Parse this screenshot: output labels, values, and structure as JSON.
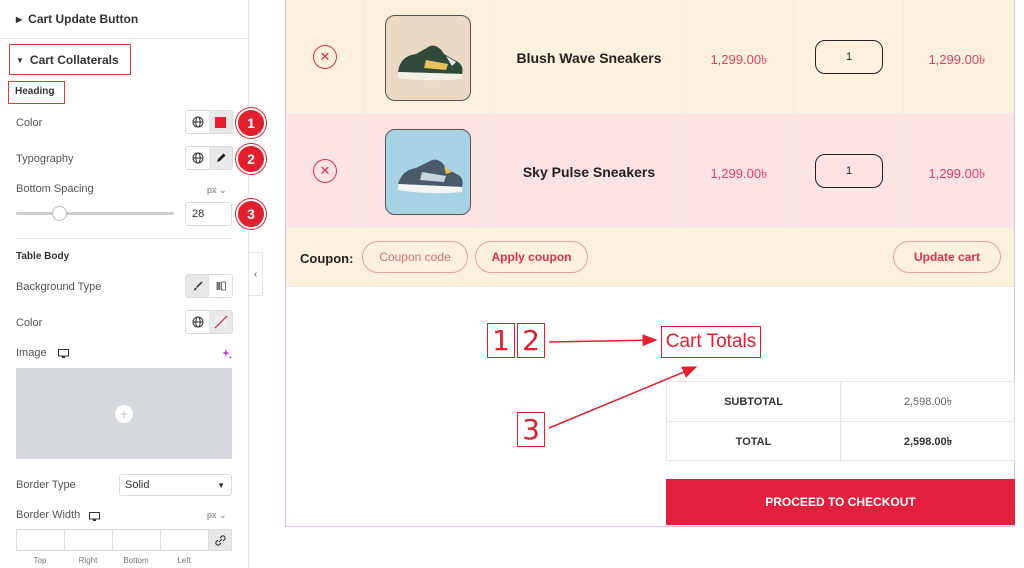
{
  "panel": {
    "section_update": "Cart Update Button",
    "section_collaterals": "Cart Collaterals",
    "heading_label": "Heading",
    "color_label": "Color",
    "typography_label": "Typography",
    "bottom_spacing_label": "Bottom Spacing",
    "bottom_spacing_unit": "px",
    "bottom_spacing_value": "28",
    "table_body_label": "Table Body",
    "bg_type_label": "Background Type",
    "color2_label": "Color",
    "image_label": "Image",
    "border_type_label": "Border Type",
    "border_type_value": "Solid",
    "border_width_label": "Border Width",
    "border_width_unit": "px",
    "dim_top": "Top",
    "dim_right": "Right",
    "dim_bottom": "Bottom",
    "dim_left": "Left",
    "badges": [
      "1",
      "2",
      "3"
    ]
  },
  "cart": {
    "items": [
      {
        "name": "Blush Wave Sneakers",
        "price": "1,299.00৳",
        "qty": "1",
        "subtotal": "1,299.00৳"
      },
      {
        "name": "Sky Pulse Sneakers",
        "price": "1,299.00৳",
        "qty": "1",
        "subtotal": "1,299.00৳"
      }
    ],
    "coupon_label": "Coupon:",
    "coupon_placeholder": "Coupon code",
    "apply_label": "Apply coupon",
    "update_label": "Update cart"
  },
  "totals": {
    "title": "Cart Totals",
    "subtotal_label": "SUBTOTAL",
    "subtotal_value": "2,598.00৳",
    "total_label": "TOTAL",
    "total_value": "2,598.00৳",
    "checkout_label": "PROCEED TO CHECKOUT"
  },
  "annotations": {
    "n1": "1",
    "n2": "2",
    "n3": "3"
  },
  "colors": {
    "accent": "#e21f2f",
    "row1_bg": "#fbf1dc",
    "row2_bg": "#fde3e4",
    "price": "#e0406a"
  }
}
